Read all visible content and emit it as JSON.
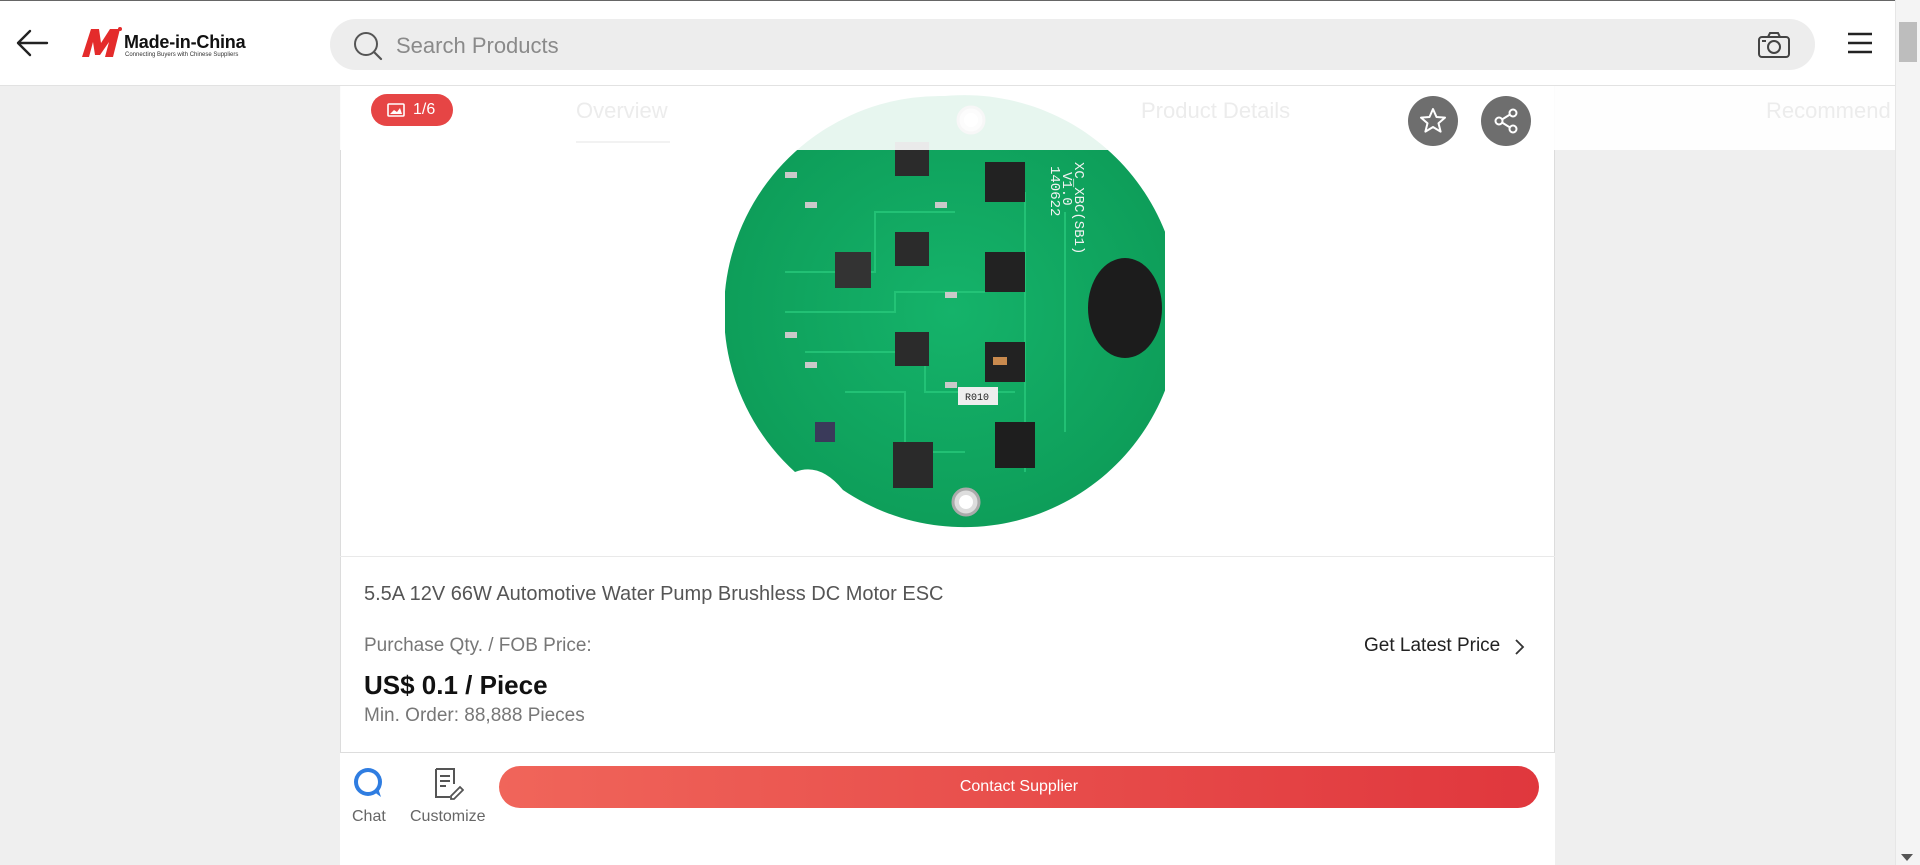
{
  "header": {
    "logo_name": "Made-in-China",
    "logo_tagline": "Connecting Buyers with Chinese Suppliers",
    "search_placeholder": "Search Products",
    "brand_color": "#e64545"
  },
  "tabs": [
    {
      "label": "Overview"
    },
    {
      "label": "Product Details"
    },
    {
      "label": "Recommend"
    }
  ],
  "gallery": {
    "counter": "1/6"
  },
  "product": {
    "title": "5.5A 12V 66W Automotive Water Pump Brushless DC Motor ESC",
    "price_label": "Purchase Qty. / FOB Price:",
    "latest_price_link": "Get Latest Price",
    "price": "US$ 0.1 / Piece",
    "min_order": "Min. Order: 88,888 Pieces",
    "pcb_marks": {
      "board_id": "XC_XBC(SB1)",
      "version": "V1.0",
      "date": "140622",
      "resistor": "R010"
    }
  },
  "actions": {
    "chat_label": "Chat",
    "customize_label": "Customize",
    "contact_label": "Contact Supplier"
  }
}
